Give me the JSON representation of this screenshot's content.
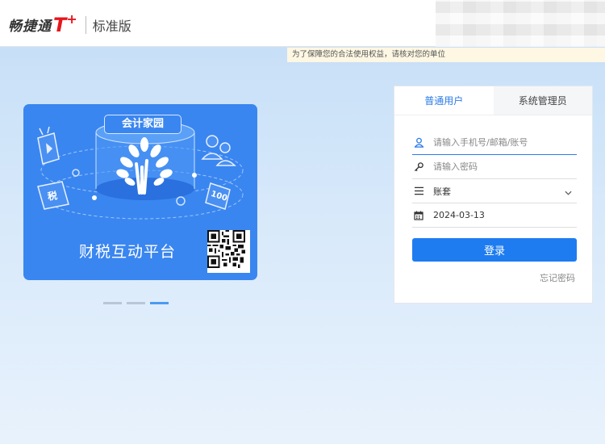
{
  "header": {
    "brand_name": "畅捷通",
    "brand_t": "T",
    "brand_plus": "+",
    "edition": "标准版"
  },
  "notice": "为了保障您的合法使用权益，请核对您的单位",
  "banner": {
    "tag": "会计家园",
    "caption": "财税互动平台",
    "left_label": "税",
    "right_label": "100",
    "dots": [
      false,
      false,
      true
    ]
  },
  "login": {
    "tabs": [
      {
        "label": "普通用户",
        "active": true
      },
      {
        "label": "系统管理员",
        "active": false
      }
    ],
    "username_placeholder": "请输入手机号/邮箱/账号",
    "password_placeholder": "请输入密码",
    "account_set_placeholder": "账套",
    "date_value": "2024-03-13",
    "login_label": "登录",
    "forgot_label": "忘记密码"
  },
  "colors": {
    "accent": "#1e7cf0",
    "brand_red": "#e8141b",
    "banner_bg": "#3a86f0"
  }
}
